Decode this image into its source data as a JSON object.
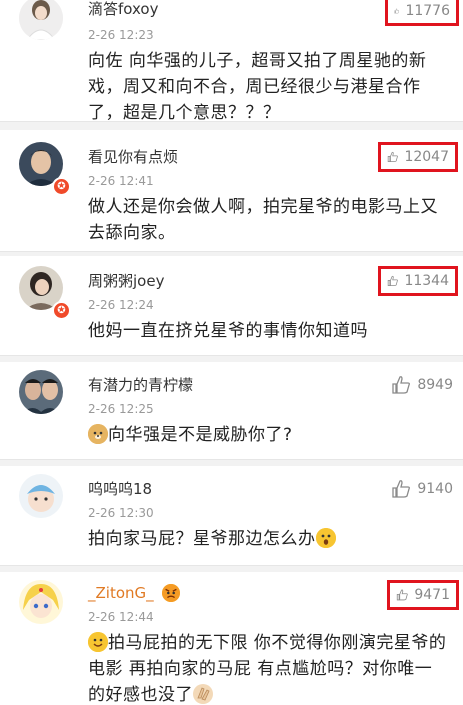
{
  "comments": [
    {
      "username": "滴答foxoy",
      "time": "2-26 12:23",
      "text": "向佐 向华强的儿子，超哥又拍了周星驰的新戏，周又和向不合，周已经很少与港星合作了，超是几个意思？？？",
      "likes": "11776",
      "highlighted": true
    },
    {
      "username": "看见你有点烦",
      "time": "2-26 12:41",
      "text": "做人还是你会做人啊，拍完星爷的电影马上又去舔向家。",
      "likes": "12047",
      "highlighted": true
    },
    {
      "username": "周粥粥joey",
      "time": "2-26 12:24",
      "text": "他妈一直在挤兑星爷的事情你知道吗",
      "likes": "11344",
      "highlighted": true
    },
    {
      "username": "有潜力的青柠檬",
      "time": "2-26 12:25",
      "text": "向华强是不是威胁你了?",
      "likes": "8949",
      "highlighted": false
    },
    {
      "username": "呜呜呜18",
      "time": "2-26 12:30",
      "text": "拍向家马屁？星爷那边怎么办",
      "likes": "9140",
      "highlighted": false
    },
    {
      "username": "_ZitonG_",
      "time": "2-26 12:44",
      "text": "拍马屁拍的无下限 你不觉得你刚演完星爷的电影 再拍向家的马屁 有点尴尬吗？对你唯一的好感也没了",
      "likes": "9471",
      "highlighted": true
    }
  ],
  "icons": {
    "like": "thumbs-up-icon",
    "badge": "verified-badge-icon",
    "doge": "doge-emoji-icon",
    "surprised": "surprised-emoji-icon",
    "smile": "smile-emoji-icon",
    "angry": "angry-emoji-icon",
    "clap": "clap-emoji-icon"
  },
  "colors": {
    "highlight_box": "#e0141e",
    "username": "#333333",
    "vip_username": "#e07a24",
    "time": "#999999",
    "like_text": "#888888"
  }
}
